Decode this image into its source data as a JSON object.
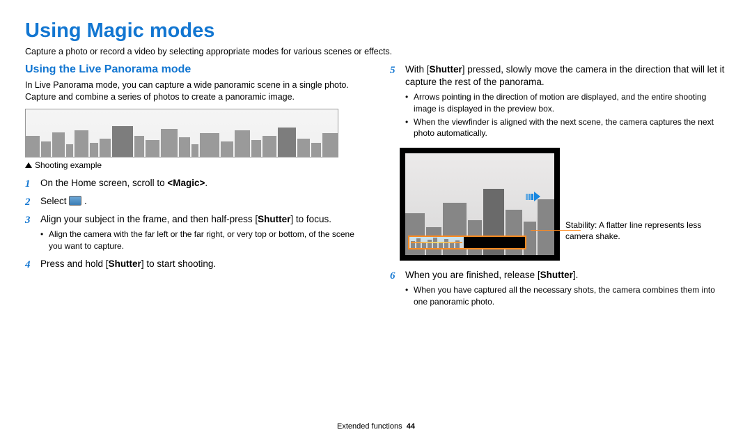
{
  "title": "Using Magic modes",
  "intro": "Capture a photo or record a video by selecting appropriate modes for various scenes or effects.",
  "left": {
    "subheading": "Using the Live Panorama mode",
    "desc": "In Live Panorama mode, you can capture a wide panoramic scene in a single photo. Capture and combine a series of photos to create a panoramic image.",
    "caption": "Shooting example",
    "step1_a": "On the Home screen, scroll to ",
    "step1_b": "<Magic>",
    "step1_c": ".",
    "step2": "Select ",
    "step2_end": ".",
    "step3_a": "Align your subject in the frame, and then half-press [",
    "step3_b": "Shutter",
    "step3_c": "] to focus.",
    "step3_sub": "Align the camera with the far left or the far right, or very top or bottom, of the scene you want to capture.",
    "step4_a": "Press and hold [",
    "step4_b": "Shutter",
    "step4_c": "] to start shooting.",
    "n1": "1",
    "n2": "2",
    "n3": "3",
    "n4": "4"
  },
  "right": {
    "step5_a": "With [",
    "step5_b": "Shutter",
    "step5_c": "] pressed, slowly move the camera in the direction that will let it capture the rest of the panorama.",
    "step5_sub1": "Arrows pointing in the direction of motion are displayed, and the entire shooting image is displayed in the preview box.",
    "step5_sub2": "When the viewfinder is aligned with the next scene, the camera captures the next photo automatically.",
    "annot": "Stability: A flatter line represents less camera shake.",
    "step6_a": "When you are finished, release [",
    "step6_b": "Shutter",
    "step6_c": "].",
    "step6_sub": "When you have captured all the necessary shots, the camera combines them into one panoramic photo.",
    "n5": "5",
    "n6": "6"
  },
  "footer_label": "Extended functions",
  "footer_page": "44"
}
